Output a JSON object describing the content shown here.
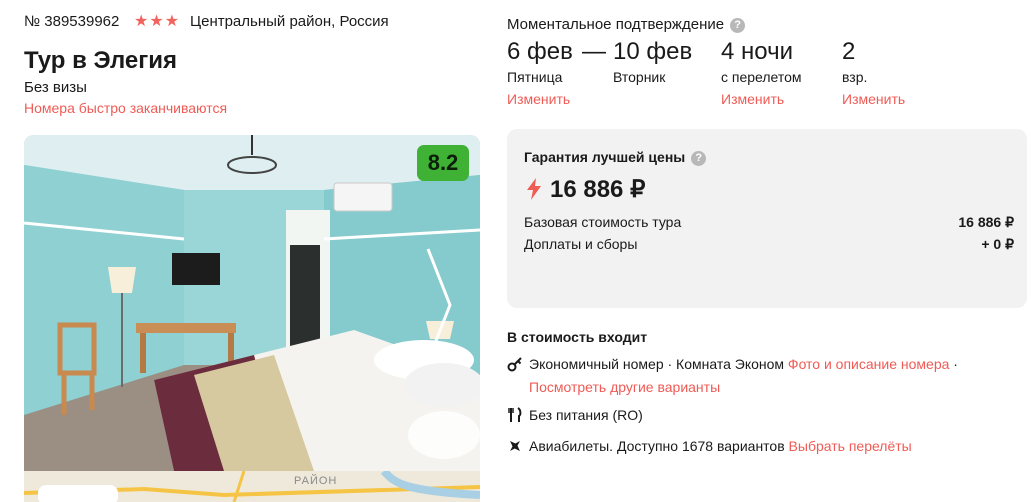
{
  "header": {
    "tour_id": "№ 389539962",
    "stars": "★★★",
    "region": "Центральный район, Россия",
    "title": "Тур в Элегия",
    "visa": "Без визы",
    "warning": "Номера быстро заканчиваются"
  },
  "photo": {
    "rating": "8.2"
  },
  "map": {
    "label": "РАЙОН"
  },
  "booking": {
    "confirm_label": "Моментальное подтверждение",
    "date_from": "6 фев",
    "dash": "—",
    "date_to": "10 фев",
    "day_from": "Пятница",
    "day_to": "Вторник",
    "nights": "4 ночи",
    "nights_sub": "с перелетом",
    "adults": "2",
    "adults_sub": "взр.",
    "change_label": "Изменить"
  },
  "price": {
    "guarantee_label": "Гарантия лучшей цены",
    "total": "16 886 ₽",
    "base_label": "Базовая стоимость тура",
    "base_value": "16 886 ₽",
    "fees_label": "Доплаты и сборы",
    "fees_value": "+ 0 ₽"
  },
  "includes": {
    "title": "В стоимость входит",
    "room": "Экономичный номер · Комната Эконом",
    "room_link": "Фото и описание номера",
    "room_dot": "·",
    "other_link": "Посмотреть другие варианты",
    "meal": "Без питания (RO)",
    "flights": "Авиабилеты. Доступно 1678 вариантов",
    "flights_link": "Выбрать перелёты"
  },
  "colors": {
    "accent": "#ef5b55",
    "rating_bg": "#3fb236",
    "price_box": "#f2f2f2"
  }
}
